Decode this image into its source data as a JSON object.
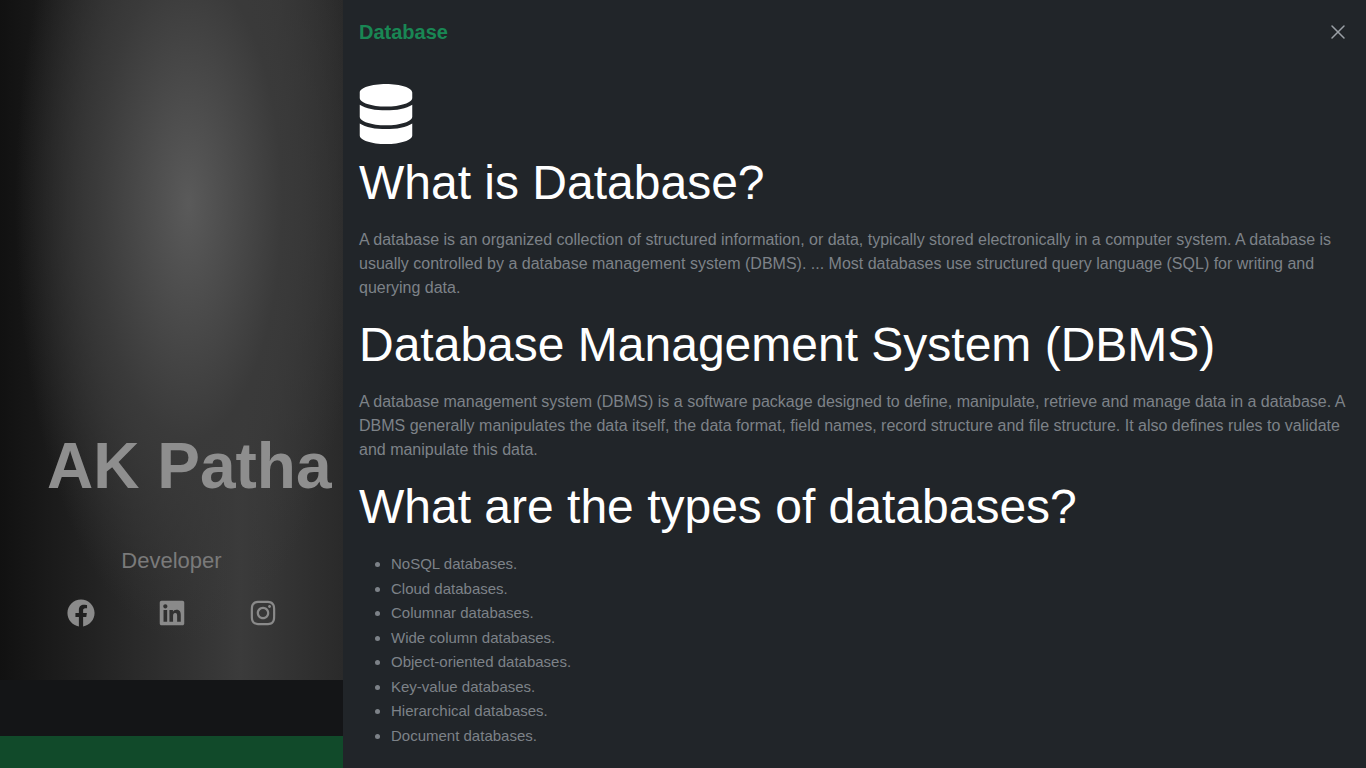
{
  "profile": {
    "name": "AK Patha",
    "role": "Developer"
  },
  "panel": {
    "title": "Database",
    "sections": [
      {
        "kind": "paragraph",
        "heading": "What is Database?",
        "body": "A database is an organized collection of structured information, or data, typically stored electronically in a computer system. A database is usually controlled by a database management system (DBMS). ... Most databases use structured query language (SQL) for writing and querying data.",
        "items": []
      },
      {
        "kind": "paragraph",
        "heading": "Database Management System (DBMS)",
        "body": "A database management system (DBMS) is a software package designed to define, manipulate, retrieve and manage data in a database. A DBMS generally manipulates the data itself, the data format, field names, record structure and file structure. It also defines rules to validate and manipulate this data.",
        "items": []
      },
      {
        "kind": "list",
        "heading": "What are the types of databases?",
        "body": "",
        "items": [
          "NoSQL databases.",
          "Cloud databases.",
          "Columnar databases.",
          "Wide column databases.",
          "Object-oriented databases.",
          "Key-value databases.",
          "Hierarchical databases.",
          "Document databases."
        ]
      }
    ]
  }
}
